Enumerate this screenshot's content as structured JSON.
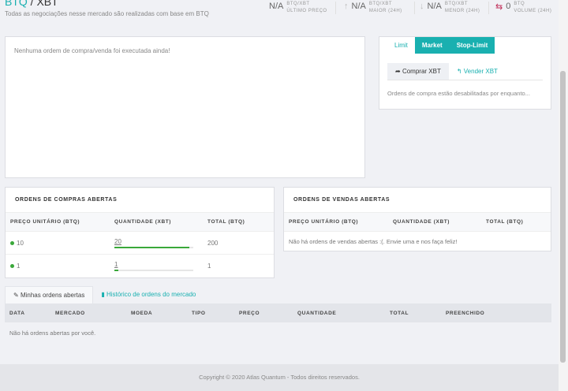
{
  "header": {
    "base": "BTQ",
    "sep": " / ",
    "quote": "XBT",
    "subtitle": "Todas as negociações nesse mercado são realizadas com base em BTQ"
  },
  "stats": [
    {
      "value": "N/A",
      "unit": "BTQ/XBT",
      "label": "ÚLTIMO PREÇO",
      "icon": ""
    },
    {
      "value": "N/A",
      "unit": "BTQ/XBT",
      "label": "MAIOR (24H)",
      "icon": "↑"
    },
    {
      "value": "N/A",
      "unit": "BTQ/XBT",
      "label": "MENOR (24H)",
      "icon": "↓"
    },
    {
      "value": "0",
      "unit": "BTQ",
      "label": "VOLUME (24H)",
      "icon": "⇆"
    }
  ],
  "trades_empty": "Nenhuma ordem de compra/venda foi executada ainda!",
  "order_form": {
    "tabs": [
      "Limit",
      "Market",
      "Stop-Limit"
    ],
    "buy": "Comprar XBT",
    "sell": "Vender XBT",
    "disabled": "Ordens de compra estão desabilitadas por enquanto..."
  },
  "buy_orders": {
    "title": "ORDENS DE COMPRAS ABERTAS",
    "cols": [
      "PREÇO UNITÁRIO (BTQ)",
      "QUANTIDADE (XBT)",
      "TOTAL (BTQ)"
    ],
    "rows": [
      {
        "price": "10",
        "qty": "20",
        "total": "200",
        "fill": 0.95
      },
      {
        "price": "1",
        "qty": "1",
        "total": "1",
        "fill": 0.05
      }
    ]
  },
  "sell_orders": {
    "title": "ORDENS DE VENDAS ABERTAS",
    "cols": [
      "PREÇO UNITÁRIO (BTQ)",
      "QUANTIDADE (XBT)",
      "TOTAL (BTQ)"
    ],
    "empty": "Não há ordens de vendas abertas :(. Envie uma e nos faça feliz!"
  },
  "my_orders": {
    "tabs": [
      "Minhas ordens abertas",
      "Histórico de ordens do mercado"
    ],
    "cols": [
      "DATA",
      "MERCADO",
      "MOEDA",
      "TIPO",
      "PREÇO",
      "QUANTIDADE",
      "TOTAL",
      "PREENCHIDO"
    ],
    "empty": "Não há ordens abertas por você."
  },
  "footer": "Copyright © 2020 Atlas Quantum - Todos direitos reservados.",
  "colors": {
    "accent": "#19b0b0",
    "green": "#3aa83a"
  }
}
